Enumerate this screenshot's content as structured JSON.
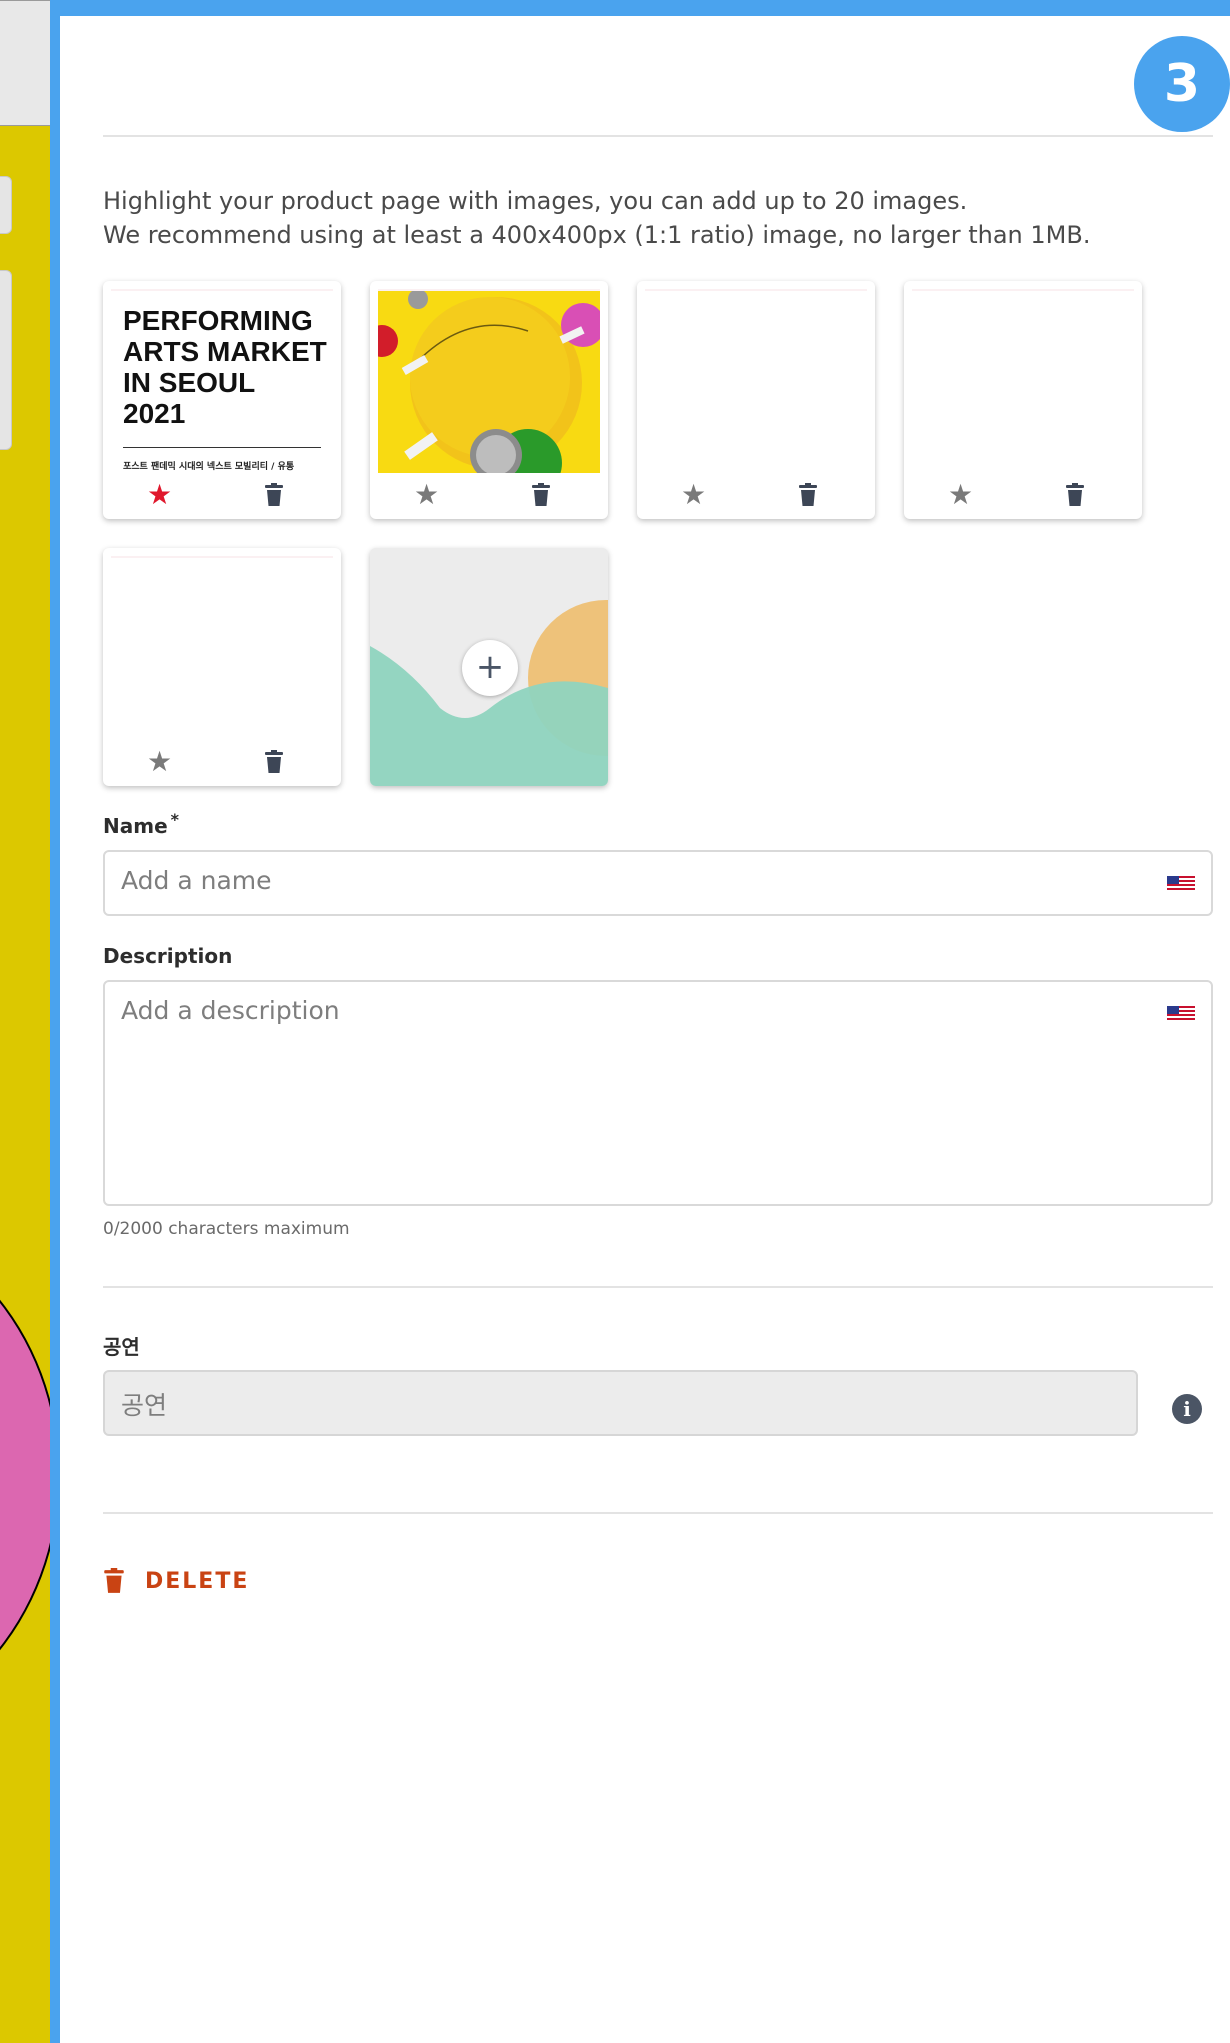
{
  "step": {
    "number": "3"
  },
  "intro": {
    "line1": "Highlight your product page with images, you can add up to 20 images.",
    "line2": "We recommend using at least a 400x400px (1:1 ratio) image, no larger than 1MB."
  },
  "images": {
    "poster_title": "PERFORMING\nARTS MARKET\nIN SEOUL\n2021",
    "poster_subtitle": "포스트 팬데믹 시대의 넥스트 모빌리티 / 유통",
    "star_glyph": "★",
    "add_glyph": "+"
  },
  "form": {
    "name": {
      "label": "Name",
      "required_mark": "*",
      "placeholder": "Add a name"
    },
    "description": {
      "label": "Description",
      "placeholder": "Add a description",
      "hint": "0/2000 characters maximum"
    },
    "category": {
      "label": "공연",
      "value": "공연",
      "info_glyph": "i"
    }
  },
  "actions": {
    "delete_label": "DELETE"
  },
  "colors": {
    "accent": "#4aa3ee",
    "star_active": "#e0182d",
    "danger": "#c94313"
  }
}
